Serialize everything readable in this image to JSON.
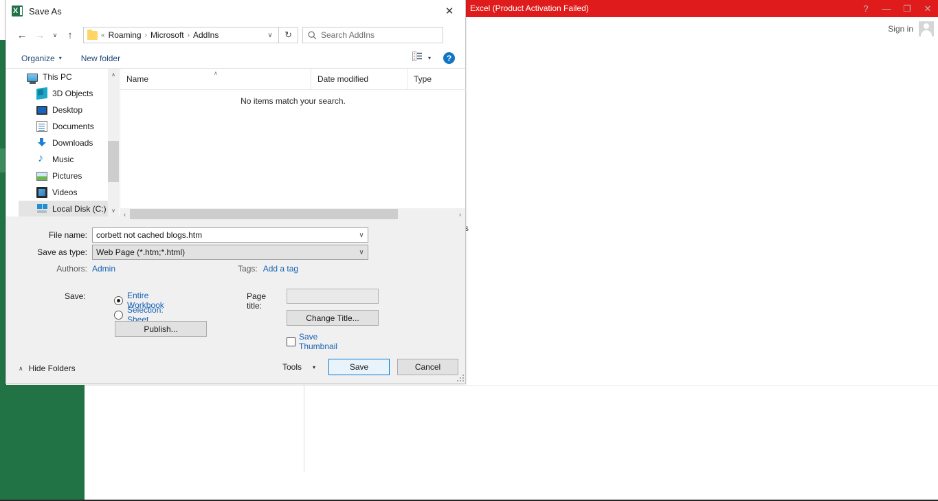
{
  "excel": {
    "title": "Excel (Product Activation Failed)",
    "window_buttons": [
      {
        "name": "help",
        "glyph": "?"
      },
      {
        "name": "minimize",
        "glyph": "—"
      },
      {
        "name": "restore",
        "glyph": "❐"
      },
      {
        "name": "close",
        "glyph": "✕"
      }
    ],
    "sign_in": "Sign in",
    "peek_text": "s",
    "colors": {
      "titlebar_red": "#e01b1b",
      "excel_green": "#217346",
      "accent_blue": "#0078d7"
    }
  },
  "dialog": {
    "title": "Save As",
    "close_glyph": "✕",
    "nav": {
      "back_glyph": "←",
      "forward_glyph": "→",
      "recent_glyph": "∨",
      "up_glyph": "↑",
      "address": {
        "prefix": "«",
        "segments": [
          "Roaming",
          "Microsoft",
          "AddIns"
        ],
        "separator": "›",
        "dropdown_glyph": "∨"
      },
      "refresh_glyph": "↻",
      "search_placeholder": "Search AddIns"
    },
    "toolbar": {
      "organize": "Organize",
      "organize_caret": "▾",
      "new_folder": "New folder",
      "view_caret": "▾",
      "help_glyph": "?"
    },
    "tree": {
      "items": [
        {
          "label": "This PC",
          "icon": "computer-icon",
          "level": 0,
          "selected": false
        },
        {
          "label": "3D Objects",
          "icon": "3d-objects-icon",
          "level": 1,
          "selected": false
        },
        {
          "label": "Desktop",
          "icon": "desktop-icon",
          "level": 1,
          "selected": false
        },
        {
          "label": "Documents",
          "icon": "documents-icon",
          "level": 1,
          "selected": false
        },
        {
          "label": "Downloads",
          "icon": "downloads-icon",
          "level": 1,
          "selected": false
        },
        {
          "label": "Music",
          "icon": "music-icon",
          "level": 1,
          "selected": false
        },
        {
          "label": "Pictures",
          "icon": "pictures-icon",
          "level": 1,
          "selected": false
        },
        {
          "label": "Videos",
          "icon": "videos-icon",
          "level": 1,
          "selected": false
        },
        {
          "label": "Local Disk (C:)",
          "icon": "disk-icon",
          "level": 1,
          "selected": true
        }
      ],
      "scroll_up_glyph": "∧",
      "scroll_down_glyph": "∨"
    },
    "list": {
      "columns": [
        "Name",
        "Date modified",
        "Type"
      ],
      "sort_caret": "∧",
      "empty_message": "No items match your search.",
      "hscroll_left_glyph": "‹",
      "hscroll_right_glyph": "›"
    },
    "form": {
      "file_name_label": "File name:",
      "file_name_value": "corbett not cached blogs.htm",
      "save_as_type_label": "Save as type:",
      "save_as_type_value": "Web Page (*.htm;*.html)",
      "combo_arrow": "∨",
      "authors_label": "Authors:",
      "authors_value": "Admin",
      "tags_label": "Tags:",
      "tags_value": "Add a tag",
      "save_label": "Save:",
      "radio_entire_workbook": "Entire Workbook",
      "radio_selection_sheet": "Selection: Sheet",
      "radio_selected": "Entire Workbook",
      "publish_button": "Publish...",
      "page_title_label": "Page title:",
      "page_title_value": "",
      "change_title_button": "Change Title...",
      "save_thumbnail_label": "Save Thumbnail",
      "save_thumbnail_checked": false
    },
    "footer": {
      "hide_folders": "Hide Folders",
      "hide_caret": "∧",
      "tools": "Tools",
      "tools_caret": "▾",
      "save_button": "Save",
      "cancel_button": "Cancel"
    }
  }
}
